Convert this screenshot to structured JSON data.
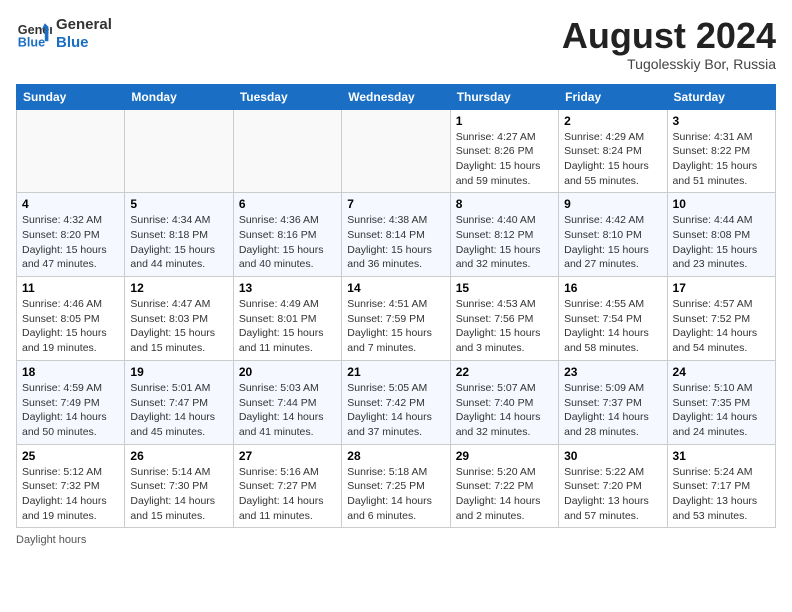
{
  "header": {
    "logo_line1": "General",
    "logo_line2": "Blue",
    "title": "August 2024",
    "subtitle": "Tugolesskiy Bor, Russia"
  },
  "days_of_week": [
    "Sunday",
    "Monday",
    "Tuesday",
    "Wednesday",
    "Thursday",
    "Friday",
    "Saturday"
  ],
  "weeks": [
    [
      {
        "day": "",
        "info": ""
      },
      {
        "day": "",
        "info": ""
      },
      {
        "day": "",
        "info": ""
      },
      {
        "day": "",
        "info": ""
      },
      {
        "day": "1",
        "info": "Sunrise: 4:27 AM\nSunset: 8:26 PM\nDaylight: 15 hours and 59 minutes."
      },
      {
        "day": "2",
        "info": "Sunrise: 4:29 AM\nSunset: 8:24 PM\nDaylight: 15 hours and 55 minutes."
      },
      {
        "day": "3",
        "info": "Sunrise: 4:31 AM\nSunset: 8:22 PM\nDaylight: 15 hours and 51 minutes."
      }
    ],
    [
      {
        "day": "4",
        "info": "Sunrise: 4:32 AM\nSunset: 8:20 PM\nDaylight: 15 hours and 47 minutes."
      },
      {
        "day": "5",
        "info": "Sunrise: 4:34 AM\nSunset: 8:18 PM\nDaylight: 15 hours and 44 minutes."
      },
      {
        "day": "6",
        "info": "Sunrise: 4:36 AM\nSunset: 8:16 PM\nDaylight: 15 hours and 40 minutes."
      },
      {
        "day": "7",
        "info": "Sunrise: 4:38 AM\nSunset: 8:14 PM\nDaylight: 15 hours and 36 minutes."
      },
      {
        "day": "8",
        "info": "Sunrise: 4:40 AM\nSunset: 8:12 PM\nDaylight: 15 hours and 32 minutes."
      },
      {
        "day": "9",
        "info": "Sunrise: 4:42 AM\nSunset: 8:10 PM\nDaylight: 15 hours and 27 minutes."
      },
      {
        "day": "10",
        "info": "Sunrise: 4:44 AM\nSunset: 8:08 PM\nDaylight: 15 hours and 23 minutes."
      }
    ],
    [
      {
        "day": "11",
        "info": "Sunrise: 4:46 AM\nSunset: 8:05 PM\nDaylight: 15 hours and 19 minutes."
      },
      {
        "day": "12",
        "info": "Sunrise: 4:47 AM\nSunset: 8:03 PM\nDaylight: 15 hours and 15 minutes."
      },
      {
        "day": "13",
        "info": "Sunrise: 4:49 AM\nSunset: 8:01 PM\nDaylight: 15 hours and 11 minutes."
      },
      {
        "day": "14",
        "info": "Sunrise: 4:51 AM\nSunset: 7:59 PM\nDaylight: 15 hours and 7 minutes."
      },
      {
        "day": "15",
        "info": "Sunrise: 4:53 AM\nSunset: 7:56 PM\nDaylight: 15 hours and 3 minutes."
      },
      {
        "day": "16",
        "info": "Sunrise: 4:55 AM\nSunset: 7:54 PM\nDaylight: 14 hours and 58 minutes."
      },
      {
        "day": "17",
        "info": "Sunrise: 4:57 AM\nSunset: 7:52 PM\nDaylight: 14 hours and 54 minutes."
      }
    ],
    [
      {
        "day": "18",
        "info": "Sunrise: 4:59 AM\nSunset: 7:49 PM\nDaylight: 14 hours and 50 minutes."
      },
      {
        "day": "19",
        "info": "Sunrise: 5:01 AM\nSunset: 7:47 PM\nDaylight: 14 hours and 45 minutes."
      },
      {
        "day": "20",
        "info": "Sunrise: 5:03 AM\nSunset: 7:44 PM\nDaylight: 14 hours and 41 minutes."
      },
      {
        "day": "21",
        "info": "Sunrise: 5:05 AM\nSunset: 7:42 PM\nDaylight: 14 hours and 37 minutes."
      },
      {
        "day": "22",
        "info": "Sunrise: 5:07 AM\nSunset: 7:40 PM\nDaylight: 14 hours and 32 minutes."
      },
      {
        "day": "23",
        "info": "Sunrise: 5:09 AM\nSunset: 7:37 PM\nDaylight: 14 hours and 28 minutes."
      },
      {
        "day": "24",
        "info": "Sunrise: 5:10 AM\nSunset: 7:35 PM\nDaylight: 14 hours and 24 minutes."
      }
    ],
    [
      {
        "day": "25",
        "info": "Sunrise: 5:12 AM\nSunset: 7:32 PM\nDaylight: 14 hours and 19 minutes."
      },
      {
        "day": "26",
        "info": "Sunrise: 5:14 AM\nSunset: 7:30 PM\nDaylight: 14 hours and 15 minutes."
      },
      {
        "day": "27",
        "info": "Sunrise: 5:16 AM\nSunset: 7:27 PM\nDaylight: 14 hours and 11 minutes."
      },
      {
        "day": "28",
        "info": "Sunrise: 5:18 AM\nSunset: 7:25 PM\nDaylight: 14 hours and 6 minutes."
      },
      {
        "day": "29",
        "info": "Sunrise: 5:20 AM\nSunset: 7:22 PM\nDaylight: 14 hours and 2 minutes."
      },
      {
        "day": "30",
        "info": "Sunrise: 5:22 AM\nSunset: 7:20 PM\nDaylight: 13 hours and 57 minutes."
      },
      {
        "day": "31",
        "info": "Sunrise: 5:24 AM\nSunset: 7:17 PM\nDaylight: 13 hours and 53 minutes."
      }
    ]
  ],
  "footer": {
    "daylight_label": "Daylight hours"
  }
}
